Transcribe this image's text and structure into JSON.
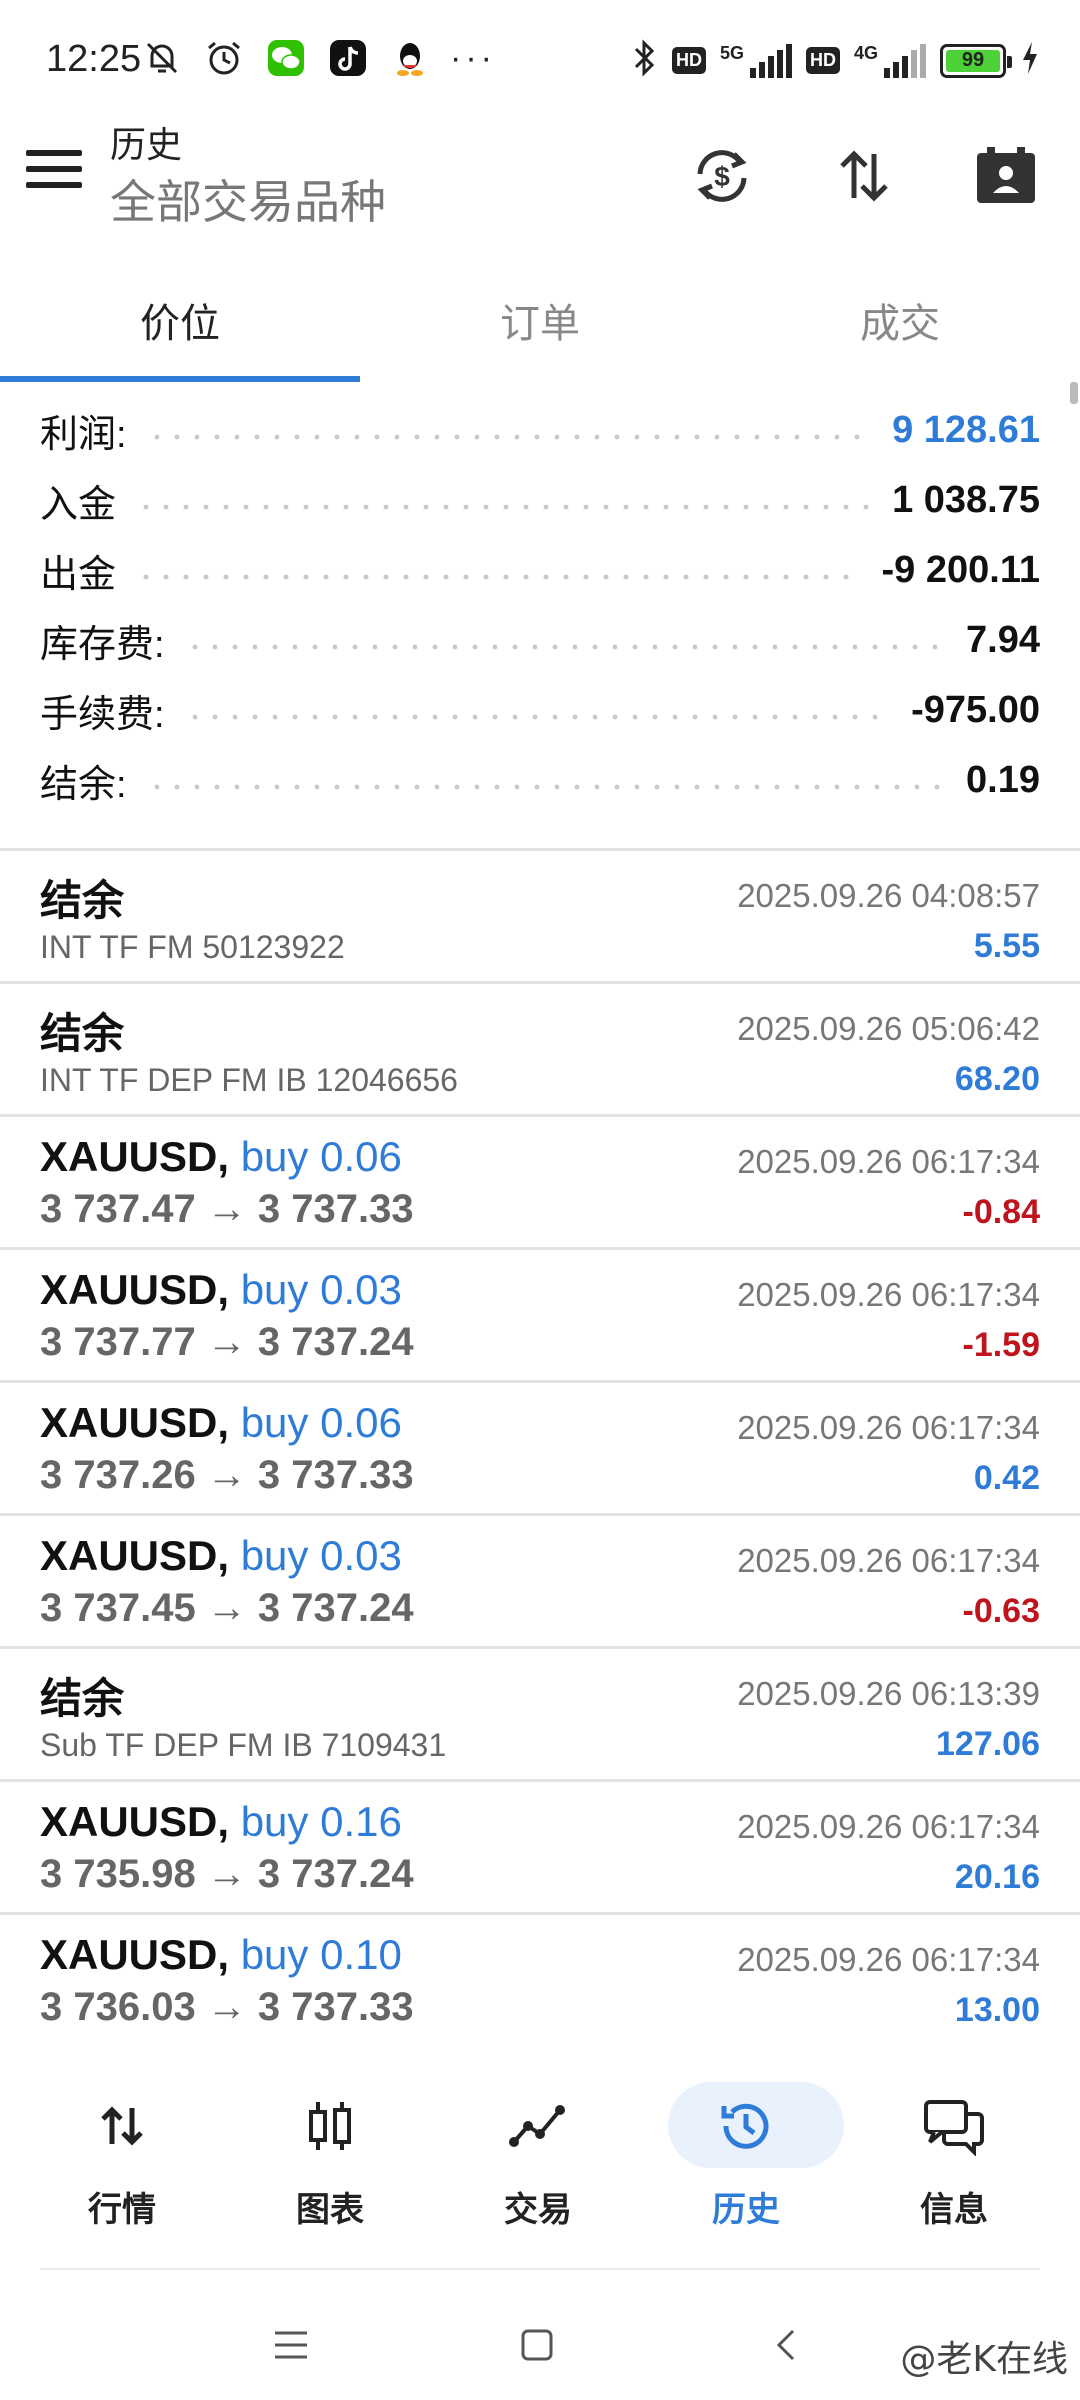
{
  "status_bar": {
    "time": "12:25",
    "battery_level": "99",
    "network_a": "5G",
    "network_b": "4G",
    "hd_label": "HD",
    "overflow": "···",
    "icons": [
      "mute-alarm-icon",
      "alarm-clock-icon",
      "wechat-icon",
      "tiktok-icon",
      "qq-icon",
      "bluetooth-icon",
      "signal-icon",
      "charging-icon"
    ]
  },
  "app_bar": {
    "title": "历史",
    "subtitle": "全部交易品种",
    "actions": [
      "currency-sync-icon",
      "sort-icon",
      "calendar-icon"
    ]
  },
  "tabs": [
    {
      "label": "价位",
      "active": true
    },
    {
      "label": "订单",
      "active": false
    },
    {
      "label": "成交",
      "active": false
    }
  ],
  "summary": [
    {
      "label": "利润:",
      "value": "9 128.61",
      "accent": true
    },
    {
      "label": "入金",
      "value": "1 038.75",
      "accent": false
    },
    {
      "label": "出金",
      "value": "-9 200.11",
      "accent": false
    },
    {
      "label": "库存费:",
      "value": "7.94",
      "accent": false
    },
    {
      "label": "手续费:",
      "value": "-975.00",
      "accent": false
    },
    {
      "label": "结余:",
      "value": "0.19",
      "accent": false
    }
  ],
  "history": [
    {
      "type": "balance",
      "title": "结余",
      "sub": "INT TF FM 50123922",
      "time": "2025.09.26 04:08:57",
      "profit": "5.55",
      "negative": false
    },
    {
      "type": "balance",
      "title": "结余",
      "sub": "INT TF DEP FM IB 12046656",
      "time": "2025.09.26 05:06:42",
      "profit": "68.20",
      "negative": false
    },
    {
      "type": "trade",
      "symbol": "XAUUSD,",
      "side": "buy 0.06",
      "prices": "3 737.47 → 3 737.33",
      "time": "2025.09.26 06:17:34",
      "profit": "-0.84",
      "negative": true
    },
    {
      "type": "trade",
      "symbol": "XAUUSD,",
      "side": "buy 0.03",
      "prices": "3 737.77 → 3 737.24",
      "time": "2025.09.26 06:17:34",
      "profit": "-1.59",
      "negative": true
    },
    {
      "type": "trade",
      "symbol": "XAUUSD,",
      "side": "buy 0.06",
      "prices": "3 737.26 → 3 737.33",
      "time": "2025.09.26 06:17:34",
      "profit": "0.42",
      "negative": false
    },
    {
      "type": "trade",
      "symbol": "XAUUSD,",
      "side": "buy 0.03",
      "prices": "3 737.45 → 3 737.24",
      "time": "2025.09.26 06:17:34",
      "profit": "-0.63",
      "negative": true
    },
    {
      "type": "balance",
      "title": "结余",
      "sub": "Sub TF DEP FM IB 7109431",
      "time": "2025.09.26 06:13:39",
      "profit": "127.06",
      "negative": false
    },
    {
      "type": "trade",
      "symbol": "XAUUSD,",
      "side": "buy 0.16",
      "prices": "3 735.98 → 3 737.24",
      "time": "2025.09.26 06:17:34",
      "profit": "20.16",
      "negative": false
    },
    {
      "type": "trade",
      "symbol": "XAUUSD,",
      "side": "buy 0.10",
      "prices": "3 736.03 → 3 737.33",
      "time": "2025.09.26 06:17:34",
      "profit": "13.00",
      "negative": false
    }
  ],
  "bottom_nav": [
    {
      "label": "行情",
      "icon": "quotes-icon",
      "active": false
    },
    {
      "label": "图表",
      "icon": "chart-icon",
      "active": false
    },
    {
      "label": "交易",
      "icon": "trade-icon",
      "active": false
    },
    {
      "label": "历史",
      "icon": "history-icon",
      "active": true
    },
    {
      "label": "信息",
      "icon": "messages-icon",
      "active": false
    }
  ],
  "watermark": "@老K在线",
  "colors": {
    "accent": "#2f7bd8",
    "negative": "#c0141c",
    "muted": "#777777"
  }
}
